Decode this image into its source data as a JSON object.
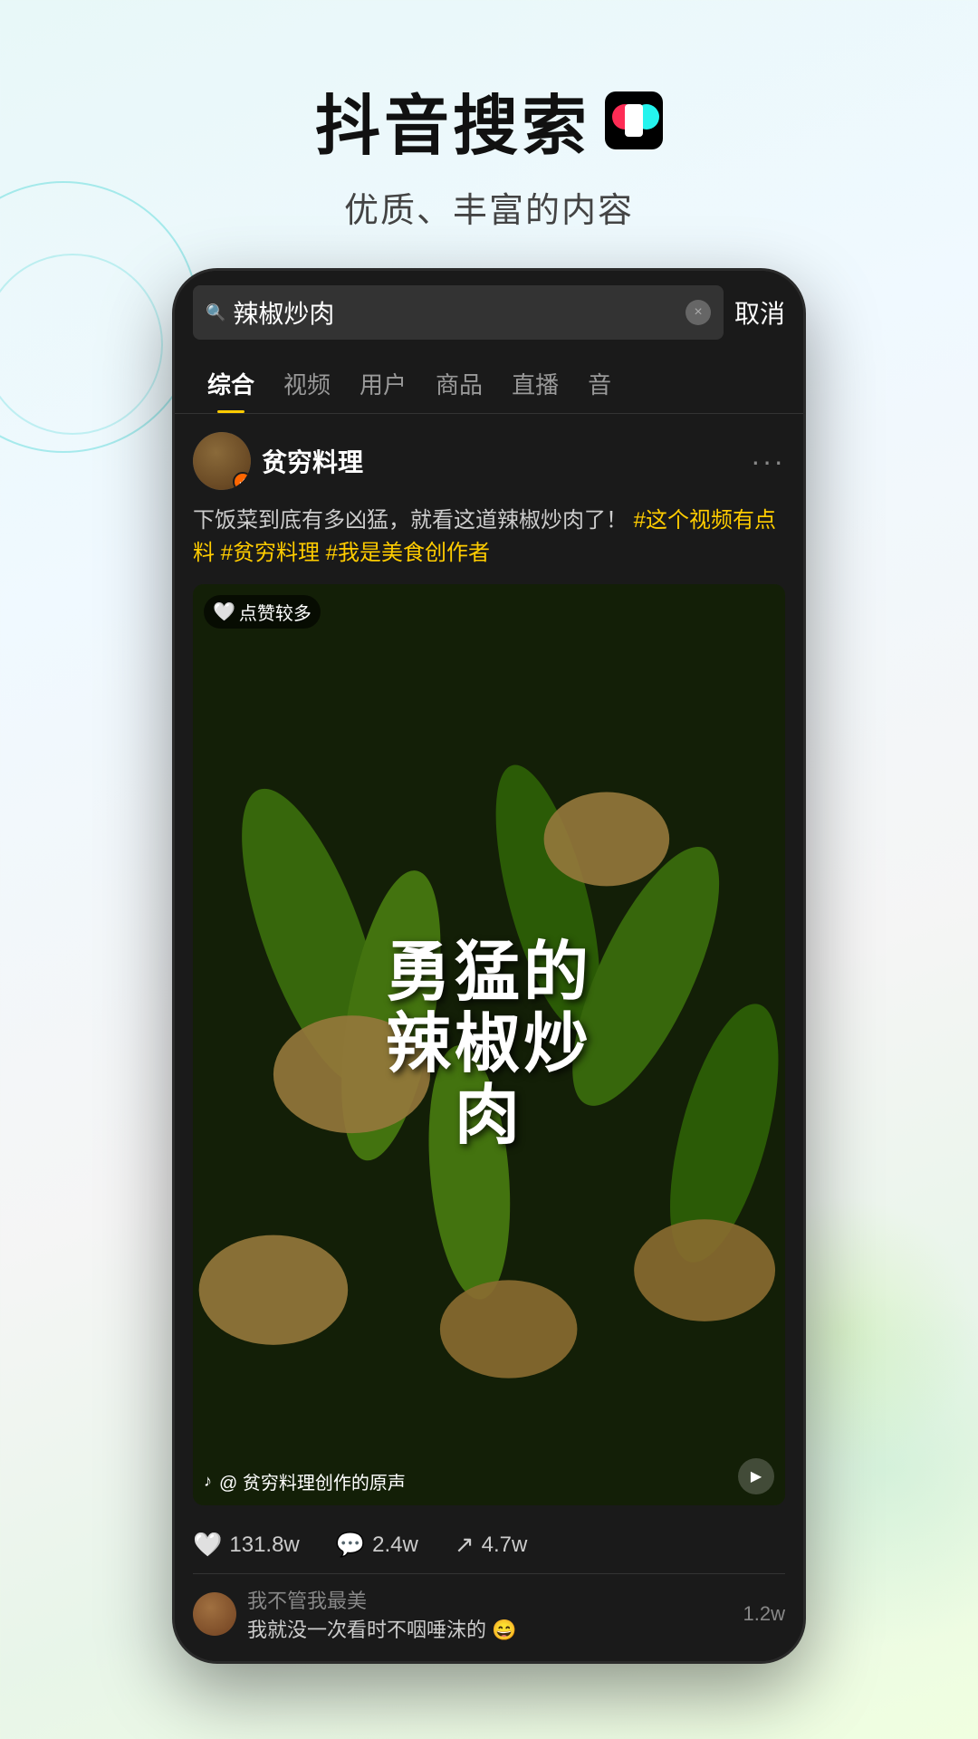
{
  "header": {
    "title": "抖音搜索",
    "subtitle": "优质、丰富的内容",
    "logo_label": "TikTok Logo"
  },
  "phone": {
    "search": {
      "query": "辣椒炒肉",
      "cancel_label": "取消",
      "clear_icon": "×"
    },
    "tabs": [
      {
        "label": "综合",
        "active": true
      },
      {
        "label": "视频",
        "active": false
      },
      {
        "label": "用户",
        "active": false
      },
      {
        "label": "商品",
        "active": false
      },
      {
        "label": "直播",
        "active": false
      },
      {
        "label": "音",
        "active": false
      }
    ],
    "post": {
      "username": "贫穷料理",
      "verified": "✓",
      "description": "下饭菜到底有多凶猛，就看这道辣椒炒肉了！",
      "hashtags": [
        "#这个视频有点料",
        "#贫穷料理",
        "#我是美食创作者"
      ],
      "like_badge": "点赞较多",
      "video_title": "勇猛的辣椒炒肉",
      "audio_label": "@ 贫穷料理创作的原声",
      "stats": {
        "likes": "131.8w",
        "comments": "2.4w",
        "shares": "4.7w"
      },
      "more_icon": "···"
    },
    "comments": [
      {
        "username": "我不管我最美",
        "content": "我就没一次看时不咽唾沫的 😄",
        "likes": "1.2w"
      }
    ]
  }
}
